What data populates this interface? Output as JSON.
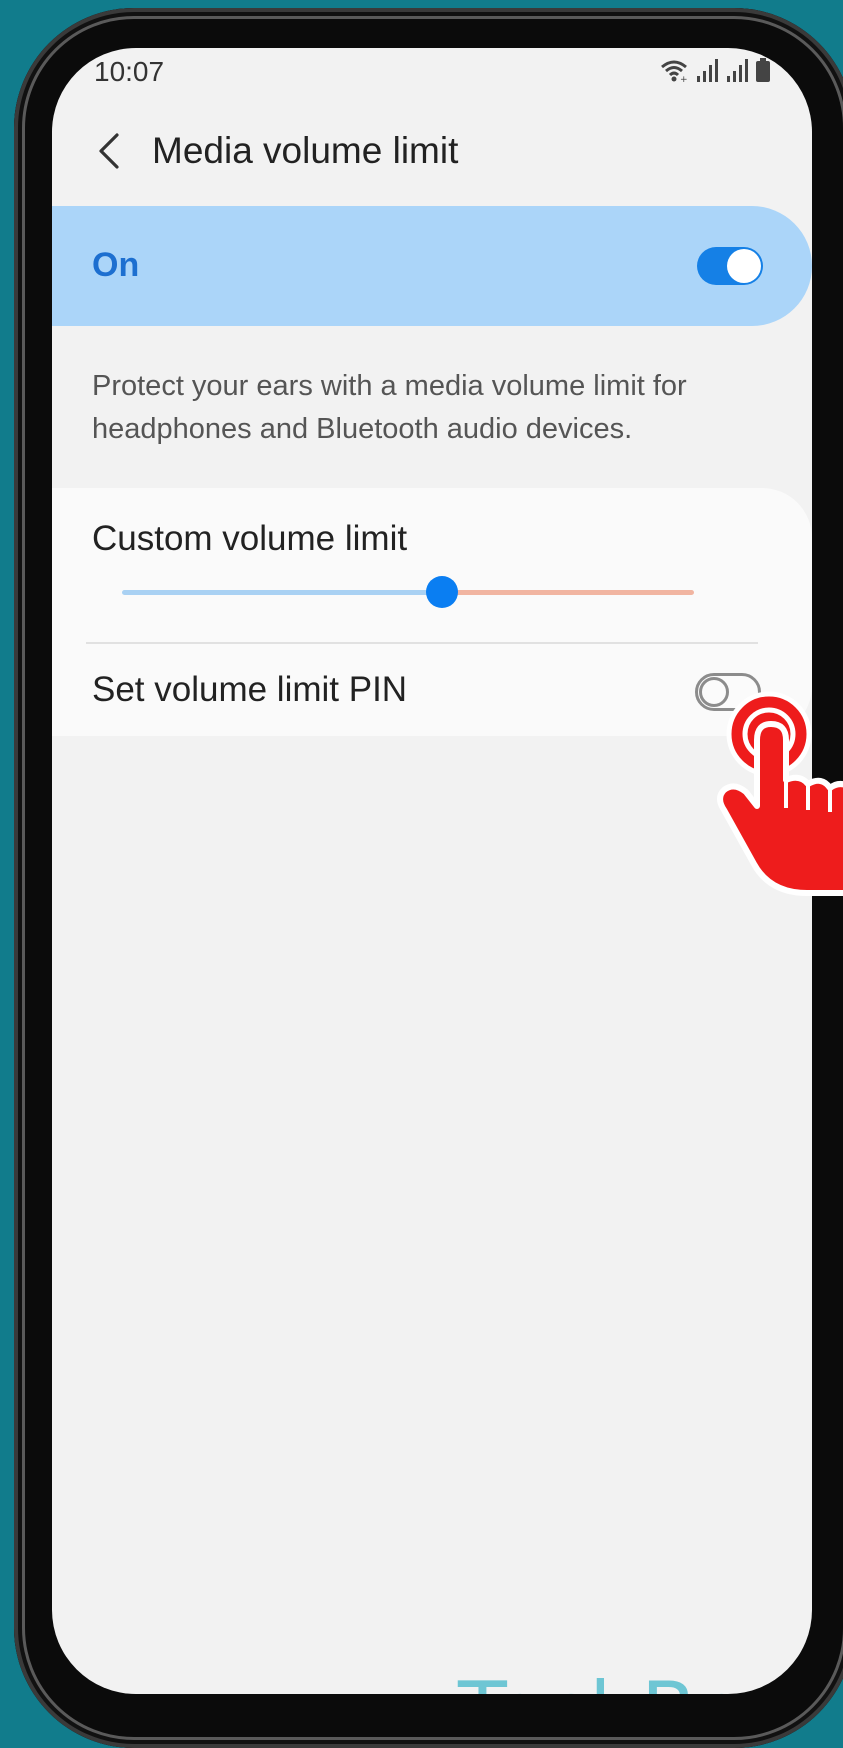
{
  "status_bar": {
    "time": "10:07",
    "icons": [
      "wifi-icon",
      "signal-icon",
      "signal-icon",
      "battery-icon"
    ]
  },
  "header": {
    "back_icon": "chevron-left-icon",
    "title": "Media volume limit"
  },
  "master_switch": {
    "label": "On",
    "state": "on"
  },
  "description": "Protect your ears with a media volume limit for headphones and Bluetooth audio devices.",
  "volume_limit": {
    "label": "Custom volume limit",
    "level_fraction": 0.56
  },
  "pin_setting": {
    "label": "Set volume limit PIN",
    "state": "off"
  },
  "overlay": {
    "cursor_icon": "tap-hand-icon"
  },
  "watermark": "TechBone",
  "colors": {
    "accent": "#1580e6",
    "switch_bar_bg": "#abd5f9",
    "switch_label": "#1d6fd0",
    "slider_left": "#a9d1f3",
    "slider_right": "#f1b5a1",
    "slider_thumb": "#0a7ef2",
    "cursor_red": "#ee1c1c",
    "watermark": "#6ec6d4",
    "background_frame": "#117c8c"
  }
}
